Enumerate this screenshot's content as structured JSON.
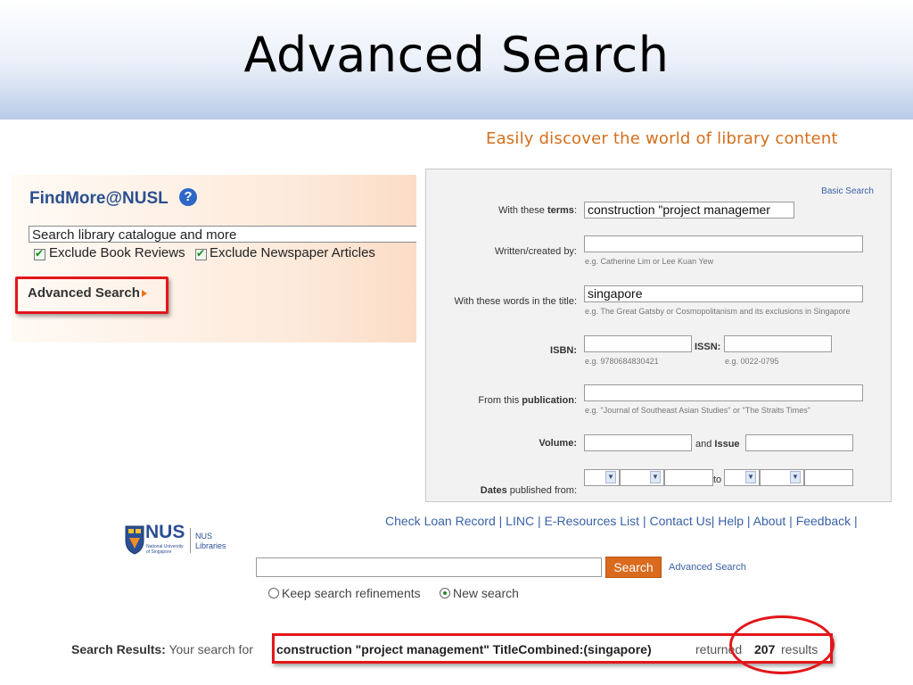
{
  "slide": {
    "title": "Advanced Search",
    "tagline": "Easily discover the world of library content"
  },
  "findmore": {
    "title": "FindMore@NUSL",
    "help_icon": "?",
    "search_placeholder": "Search library catalogue and more",
    "checkboxes": [
      {
        "label": "Exclude Book Reviews",
        "checked": true
      },
      {
        "label": "Exclude Newspaper Articles",
        "checked": true
      }
    ],
    "advanced_link": "Advanced Search"
  },
  "form": {
    "basic_search_link": "Basic Search",
    "terms_label_prefix": "With these ",
    "terms_label_bold": "terms",
    "terms_value": "construction \"project managemer",
    "author_label": "Written/created by:",
    "author_hint": "e.g. Catherine Lim or Lee Kuan Yew",
    "title_label": "With these words in the title:",
    "title_value": "singapore",
    "title_hint": "e.g. The Great Gatsby or Cosmopolitanism and its exclusions in Singapore",
    "isbn_label": "ISBN:",
    "isbn_hint": "e.g. 9780684830421",
    "issn_label": "ISSN:",
    "issn_hint": "e.g. 0022-0795",
    "publication_label_prefix": "From this ",
    "publication_label_bold": "publication",
    "publication_hint": "e.g. \"Journal of Southeast Asian Studies\" or \"The Straits Times\"",
    "volume_label": "Volume:",
    "issue_label_prefix": "and ",
    "issue_label_bold": "Issue",
    "dates_label_bold": "Dates",
    "dates_label_rest": " published from:",
    "to_label": "to"
  },
  "nus": {
    "logo_text": "NUS",
    "logo_sub": "National University of Singapore",
    "libraries_line1": "NUS",
    "libraries_line2": "Libraries",
    "top_links": "Check Loan Record | LINC | E-Resources List | Contact Us| Help | About | Feedback |",
    "search_button": "Search",
    "advanced_link": "Advanced Search",
    "radio_keep": "Keep search refinements",
    "radio_new": "New search"
  },
  "results": {
    "label": "Search Results:",
    "prefix": "Your search for",
    "query": "construction \"project management\" TitleCombined:(singapore)",
    "returned": "returned",
    "count": "207",
    "suffix": "results"
  },
  "colors": {
    "highlight": "#e3161b",
    "accent_orange": "#d96a1e",
    "link_blue": "#3a62a8"
  }
}
